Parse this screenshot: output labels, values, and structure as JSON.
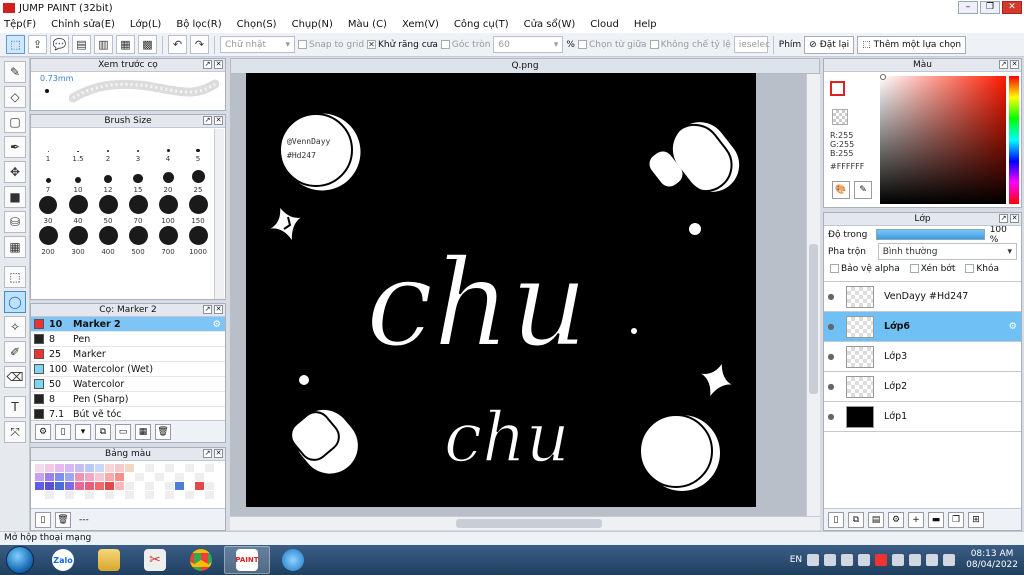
{
  "window": {
    "title": "JUMP PAINT (32bit)"
  },
  "menu": [
    "Tệp(F)",
    "Chỉnh sửa(E)",
    "Lớp(L)",
    "Bộ lọc(R)",
    "Chọn(S)",
    "Chụp(N)",
    "Màu (C)",
    "Xem(V)",
    "Công cụ(T)",
    "Cửa sổ(W)",
    "Cloud",
    "Help"
  ],
  "toolbar": {
    "shape_select": "Chữ nhật",
    "snap_grid": "Snap to grid",
    "antialias": "Khử răng cưa",
    "corner": "Góc tròn",
    "corner_value": "60",
    "percent": "%",
    "select_center": "Chọn từ giữa",
    "ratio_mode": "Không chế tỷ lệ",
    "ratio_field": "ieselec",
    "key_label": "Phím",
    "reset": "Đặt lại",
    "add_selection": "Thêm một lựa chọn"
  },
  "preview_panel": {
    "title": "Xem trước cọ",
    "size_value": "0.73mm"
  },
  "brush_size_panel": {
    "title": "Brush Size",
    "sizes": [
      {
        "label": "1",
        "d": 1
      },
      {
        "label": "1.5",
        "d": 1.5
      },
      {
        "label": "2",
        "d": 2
      },
      {
        "label": "3",
        "d": 2.5
      },
      {
        "label": "4",
        "d": 3
      },
      {
        "label": "5",
        "d": 3.5
      },
      {
        "label": "7",
        "d": 5
      },
      {
        "label": "10",
        "d": 6.5
      },
      {
        "label": "12",
        "d": 8
      },
      {
        "label": "15",
        "d": 9.5
      },
      {
        "label": "20",
        "d": 11
      },
      {
        "label": "25",
        "d": 13
      },
      {
        "label": "30",
        "d": 18
      },
      {
        "label": "40",
        "d": 19
      },
      {
        "label": "50",
        "d": 19
      },
      {
        "label": "70",
        "d": 19
      },
      {
        "label": "100",
        "d": 19
      },
      {
        "label": "150",
        "d": 19
      },
      {
        "label": "200",
        "d": 19
      },
      {
        "label": "300",
        "d": 19
      },
      {
        "label": "400",
        "d": 19
      },
      {
        "label": "500",
        "d": 19
      },
      {
        "label": "700",
        "d": 19
      },
      {
        "label": "1000",
        "d": 19
      }
    ]
  },
  "brush_panel": {
    "title": "Cọ: Marker 2",
    "items": [
      {
        "size": "10",
        "name": "Marker 2",
        "color": "#e83434",
        "selected": true
      },
      {
        "size": "8",
        "name": "Pen",
        "color": "#222222",
        "selected": false
      },
      {
        "size": "25",
        "name": "Marker",
        "color": "#e83434",
        "selected": false
      },
      {
        "size": "100",
        "name": "Watercolor (Wet)",
        "color": "#7fd4f2",
        "selected": false
      },
      {
        "size": "50",
        "name": "Watercolor",
        "color": "#7fd4f2",
        "selected": false
      },
      {
        "size": "8",
        "name": "Pen (Sharp)",
        "color": "#222222",
        "selected": false
      },
      {
        "size": "7.1",
        "name": "Bút vẽ tóc",
        "color": "#222222",
        "selected": false
      }
    ]
  },
  "palette_panel": {
    "title": "Bảng màu",
    "footer_text": "---",
    "colors": [
      "#f6d9ee",
      "#f1c8e6",
      "#eab8f0",
      "#d7b6f4",
      "#c8bdf3",
      "#b9c9f4",
      "#c6d9f7",
      "#f7d5d5",
      "#f7c9c9",
      "#f2d7c5",
      "#fff",
      "#eee",
      "#fff",
      "#eee",
      "#fff",
      "#eee",
      "#fff",
      "#eee",
      "#c6a1ee",
      "#9a82ee",
      "#7f8ff0",
      "#9ba8f2",
      "#ec96b4",
      "#f2a7c2",
      "#f5c6d4",
      "#f7aaaa",
      "#f78e8e",
      "#fff",
      "#eee",
      "#fff",
      "#eee",
      "#fff",
      "#eee",
      "#fff",
      "#eee",
      "#fff",
      "#5c5fe6",
      "#5a4fd6",
      "#4a6cd6",
      "#7f6be6",
      "#e8679b",
      "#ea5e7a",
      "#f06a6a",
      "#e14848",
      "#fbb7b7",
      "#eee",
      "#fff",
      "#eee",
      "#fff",
      "#eee",
      "#4b7fd6",
      "#fff",
      "#e14848",
      "#eee",
      "#fff",
      "#eee",
      "#fff",
      "#eee",
      "#fff",
      "#eee",
      "#fff",
      "#eee",
      "#fff",
      "#eee",
      "#fff",
      "#eee",
      "#fff",
      "#eee",
      "#fff",
      "#eee",
      "#fff",
      "#eee"
    ]
  },
  "document": {
    "tab": "Q.png"
  },
  "artwork": {
    "watermark_line1": "@VennDayy",
    "watermark_line2": "#Hd247",
    "word_big": "chu",
    "word_small": "chu"
  },
  "color_panel": {
    "title": "Màu",
    "r": "R:255",
    "g": "G:255",
    "b": "B:255",
    "hex": "#FFFFFF"
  },
  "layer_panel": {
    "title": "Lớp",
    "opacity_label": "Độ trong",
    "opacity_value": "100 %",
    "opacity_fraction": 1.0,
    "blend_label": "Pha trộn",
    "blend_value": "Bình thường",
    "protect_alpha": "Bảo vệ alpha",
    "clip": "Xén bớt",
    "lock": "Khóa",
    "layers": [
      {
        "name": "VenDayy #Hd247",
        "selected": false,
        "thumb": "transparent"
      },
      {
        "name": "Lớp6",
        "selected": true,
        "thumb": "transparent"
      },
      {
        "name": "Lớp3",
        "selected": false,
        "thumb": "transparent"
      },
      {
        "name": "Lớp2",
        "selected": false,
        "thumb": "transparent"
      },
      {
        "name": "Lớp1",
        "selected": false,
        "thumb": "black"
      }
    ]
  },
  "status": {
    "text": "Mở hộp thoại mạng"
  },
  "taskbar": {
    "zalo": "Zalo",
    "jump_paint_icon": "PAINT",
    "lang": "EN",
    "time": "08:13 AM",
    "date": "08/04/2022"
  }
}
